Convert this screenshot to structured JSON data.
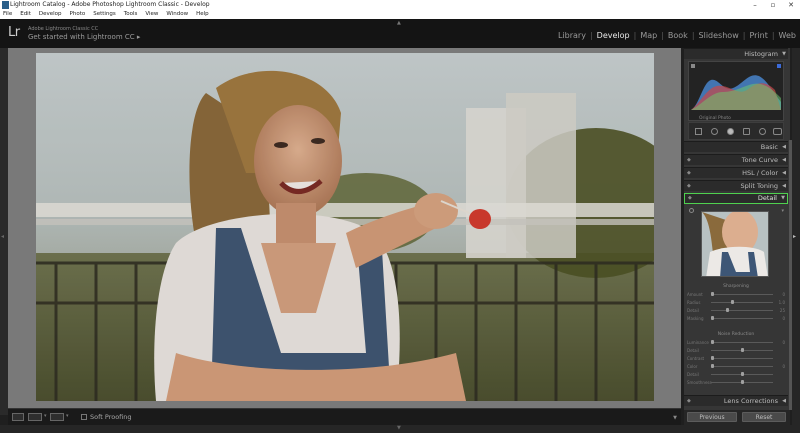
{
  "window": {
    "title": "Lightroom Catalog - Adobe Photoshop Lightroom Classic - Develop",
    "minimize": "–",
    "maximize": "▫",
    "close": "✕"
  },
  "menu": [
    "File",
    "Edit",
    "Develop",
    "Photo",
    "Settings",
    "Tools",
    "View",
    "Window",
    "Help"
  ],
  "identity": {
    "logo": "Lr",
    "line1": "Adobe Lightroom Classic CC",
    "line2": "Get started with Lightroom CC ▸"
  },
  "modules": [
    {
      "label": "Library",
      "active": false
    },
    {
      "label": "Develop",
      "active": true
    },
    {
      "label": "Map",
      "active": false
    },
    {
      "label": "Book",
      "active": false
    },
    {
      "label": "Slideshow",
      "active": false
    },
    {
      "label": "Print",
      "active": false
    },
    {
      "label": "Web",
      "active": false
    }
  ],
  "toolbar": {
    "soft_proofing": "Soft Proofing"
  },
  "panel": {
    "histogram": "Histogram",
    "original_photo": "Original Photo",
    "basic": "Basic",
    "tone_curve": "Tone Curve",
    "hsl_color": "HSL / Color",
    "split_toning": "Split Toning",
    "detail": "Detail",
    "lens_corrections": "Lens Corrections",
    "sharpening": "Sharpening",
    "noise_reduction": "Noise Reduction"
  },
  "sharpening_sliders": [
    {
      "label": "Amount",
      "value": "0",
      "level": 0.0
    },
    {
      "label": "Radius",
      "value": "1.0",
      "level": 0.33
    },
    {
      "label": "Detail",
      "value": "25",
      "level": 0.25
    },
    {
      "label": "Masking",
      "value": "0",
      "level": 0.0
    }
  ],
  "noise_sliders": [
    {
      "label": "Luminance",
      "value": "0",
      "level": 0.0
    },
    {
      "label": "Detail",
      "value": "",
      "level": 0.5
    },
    {
      "label": "Contrast",
      "value": "",
      "level": 0.0
    },
    {
      "label": "Color",
      "value": "0",
      "level": 0.0
    },
    {
      "label": "Detail",
      "value": "",
      "level": 0.5
    },
    {
      "label": "Smoothness",
      "value": "",
      "level": 0.5
    }
  ],
  "footer": {
    "previous": "Previous",
    "reset": "Reset"
  },
  "colors": {
    "highlight": "#4fd14f",
    "panel_bg": "#363636",
    "canvas_bg": "#797979"
  }
}
